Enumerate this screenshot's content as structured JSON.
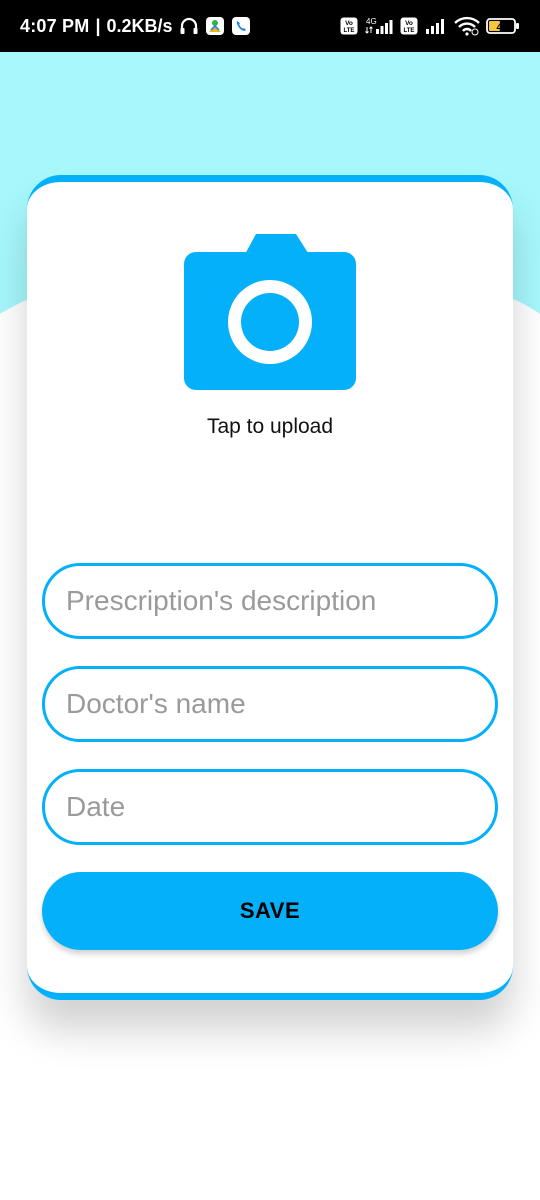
{
  "status_bar": {
    "time": "4:07 PM",
    "separator": "|",
    "network_speed": "0.2KB/s",
    "battery_level": "46",
    "network_type": "4G",
    "volte_label": "Vo LTE"
  },
  "colors": {
    "accent": "#03b0f9",
    "header_bg": "#a6f8fd",
    "card_bg": "#ffffff",
    "placeholder": "#9a9a9a"
  },
  "upload": {
    "icon": "camera-icon",
    "label": "Tap to upload"
  },
  "form": {
    "description_placeholder": "Prescription's description",
    "doctor_placeholder": "Doctor's name",
    "date_placeholder": "Date",
    "description_value": "",
    "doctor_value": "",
    "date_value": ""
  },
  "actions": {
    "save_label": "SAVE"
  }
}
